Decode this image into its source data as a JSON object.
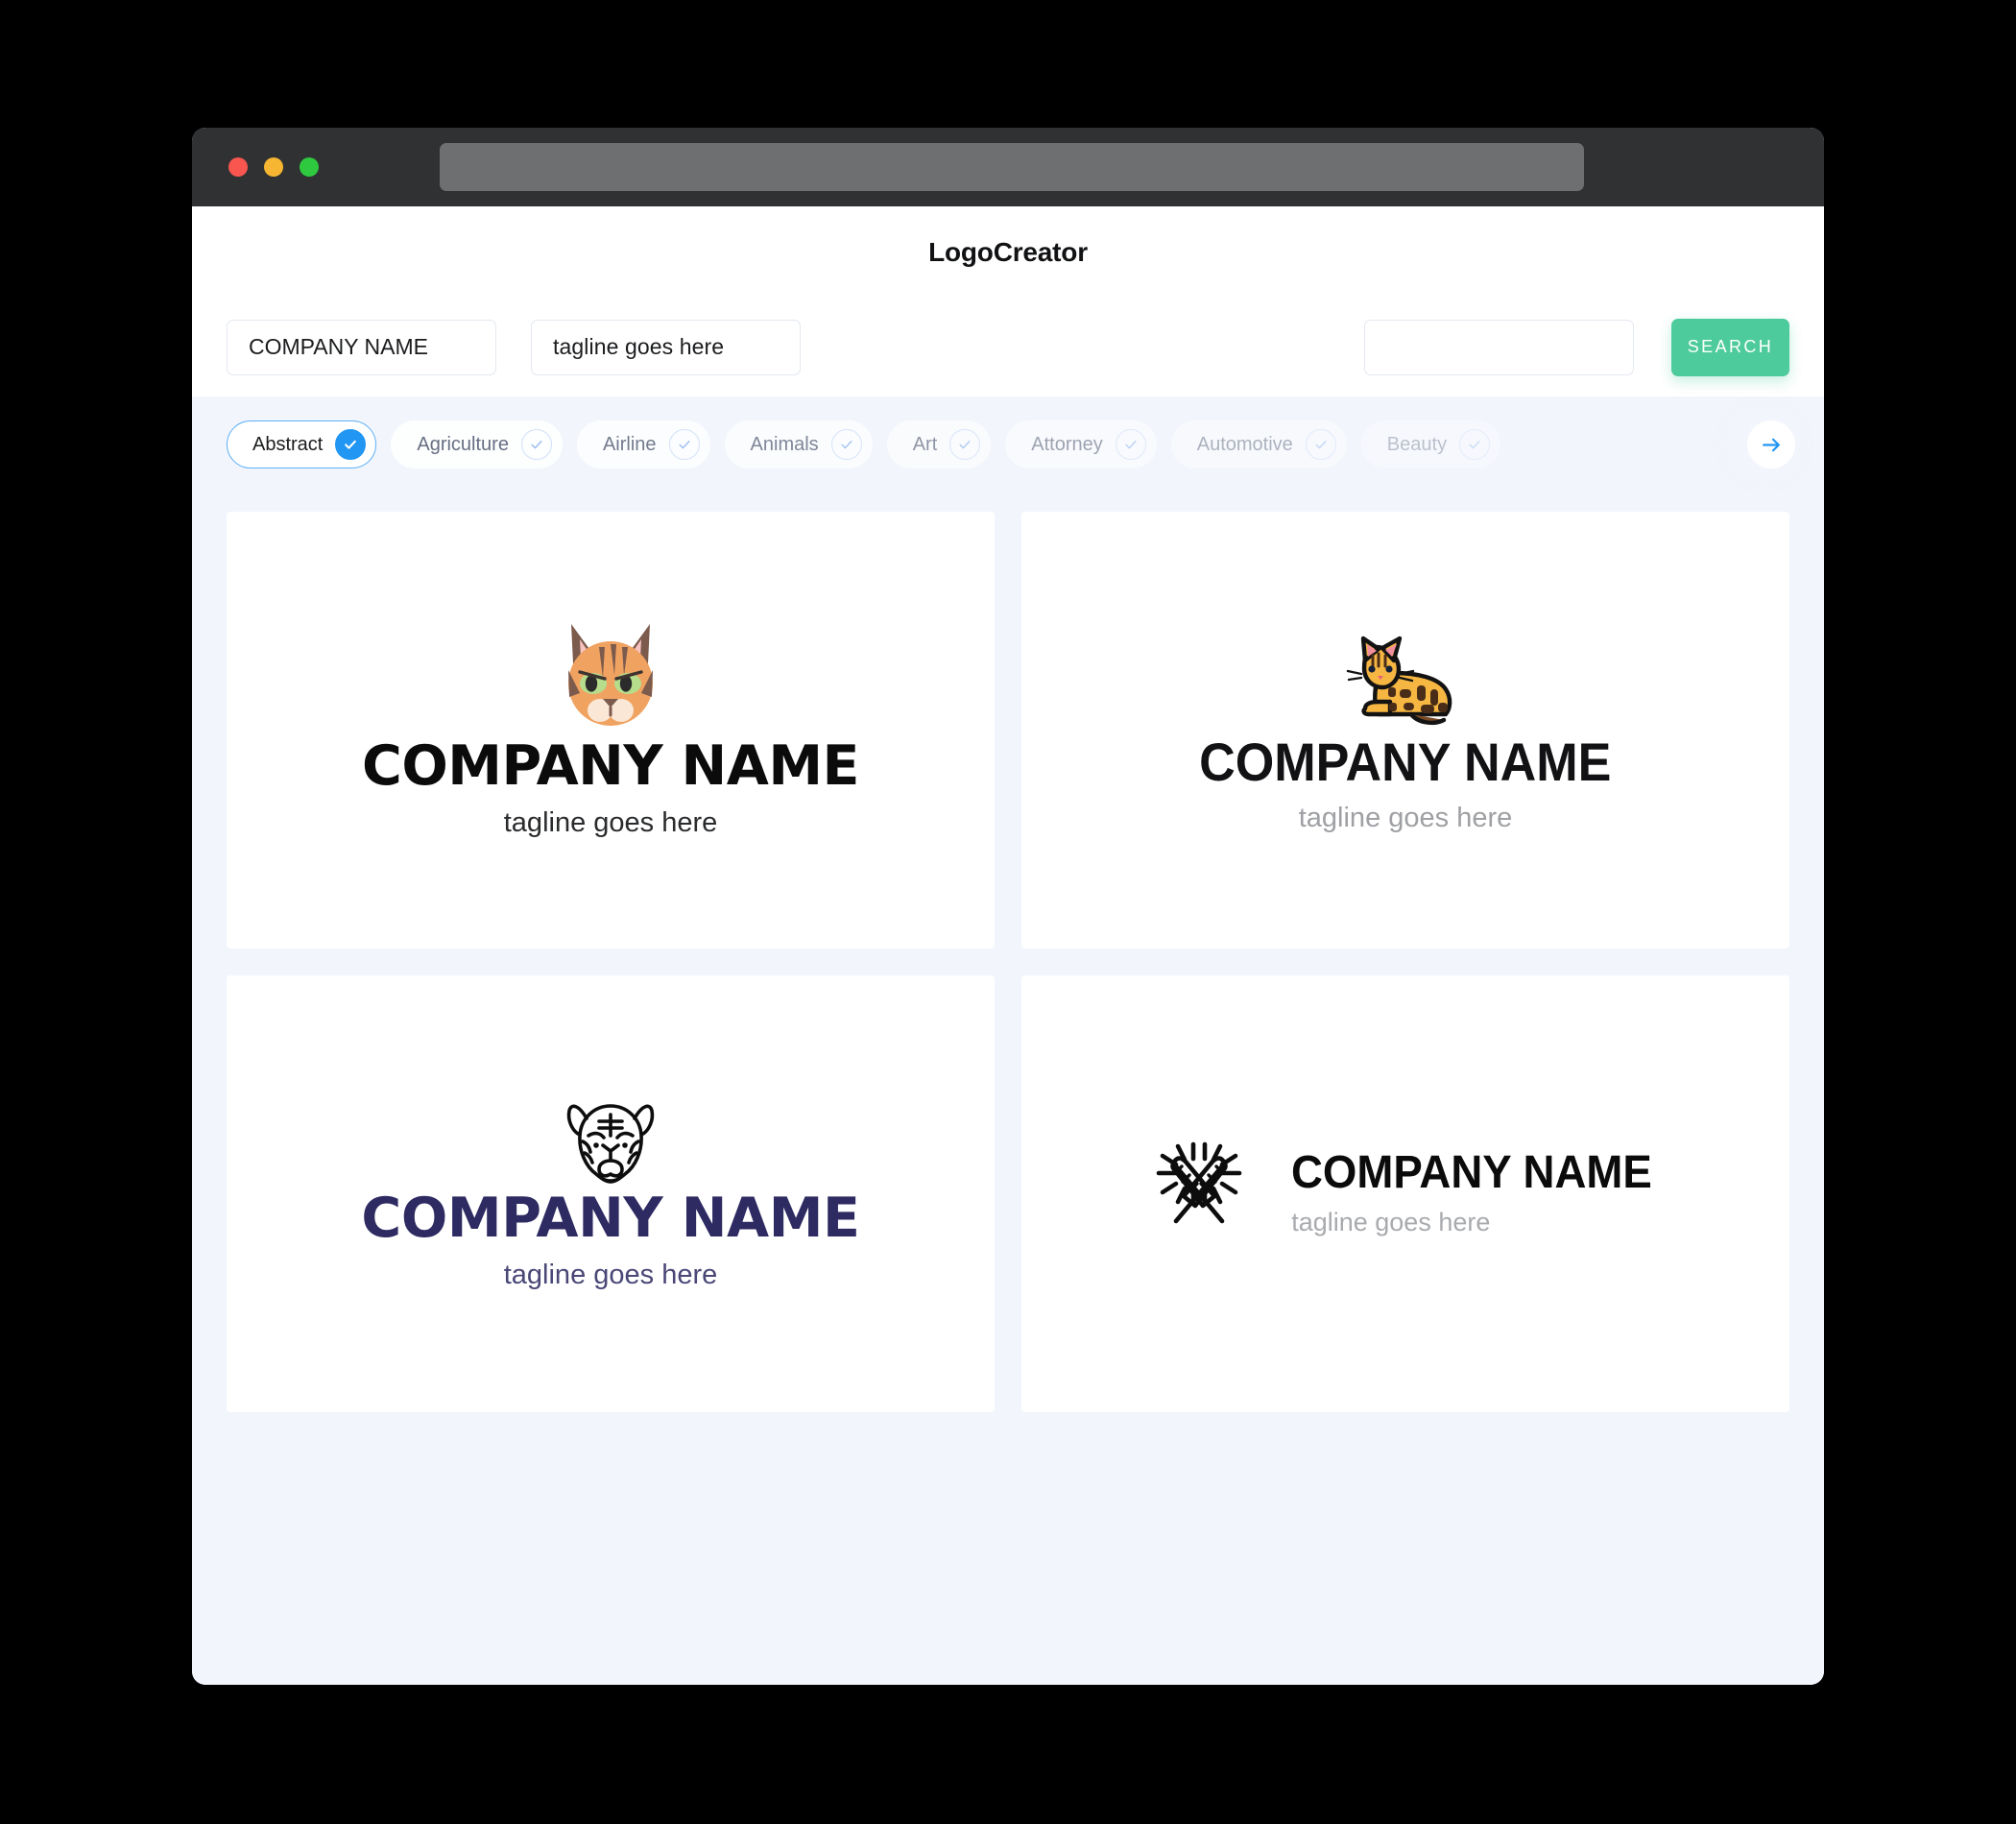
{
  "window": {
    "traffic_lights": [
      {
        "name": "close",
        "color": "#f9564f"
      },
      {
        "name": "minimize",
        "color": "#f6b632"
      },
      {
        "name": "maximize",
        "color": "#2ec93f"
      }
    ],
    "address_bar_value": ""
  },
  "header": {
    "app_title": "LogoCreator"
  },
  "search": {
    "company_name_value": "COMPANY NAME",
    "company_name_placeholder": "COMPANY NAME",
    "tagline_value": "tagline goes here",
    "tagline_placeholder": "tagline goes here",
    "extra_value": "",
    "extra_placeholder": "",
    "search_button_label": "SEARCH",
    "search_button_color": "#4ecb9c"
  },
  "categories": {
    "accent_selected": "#2196f3",
    "next_arrow_color": "#2196f3",
    "items": [
      {
        "label": "Abstract",
        "selected": true
      },
      {
        "label": "Agriculture",
        "selected": false
      },
      {
        "label": "Airline",
        "selected": false
      },
      {
        "label": "Animals",
        "selected": false
      },
      {
        "label": "Art",
        "selected": false
      },
      {
        "label": "Attorney",
        "selected": false
      },
      {
        "label": "Automotive",
        "selected": false
      },
      {
        "label": "Beauty",
        "selected": false
      }
    ],
    "next_label": "next"
  },
  "results": {
    "cards": [
      {
        "icon": "cat-face-icon",
        "name": "COMPANY NAME",
        "tagline": "tagline goes here",
        "name_color": "#0b0b0c",
        "tagline_color": "#2a2b2d",
        "layout": "stacked"
      },
      {
        "icon": "bengal-cat-icon",
        "name": "COMPANY NAME",
        "tagline": "tagline goes here",
        "name_color": "#121214",
        "tagline_color": "#9ea0a3",
        "layout": "stacked"
      },
      {
        "icon": "tiger-head-icon",
        "name": "COMPANY NAME",
        "tagline": "tagline goes here",
        "name_color": "#2e2a62",
        "tagline_color": "#4a4777",
        "layout": "stacked"
      },
      {
        "icon": "crossed-sparklers-icon",
        "name": "COMPANY NAME",
        "tagline": "tagline goes here",
        "name_color": "#0b0b0c",
        "tagline_color": "#a8aaad",
        "layout": "horizontal"
      }
    ]
  },
  "colors": {
    "page_background": "#f2f5fc",
    "card_background": "#ffffff",
    "titlebar": "#2f3133",
    "addressbar": "#6e6f70"
  }
}
